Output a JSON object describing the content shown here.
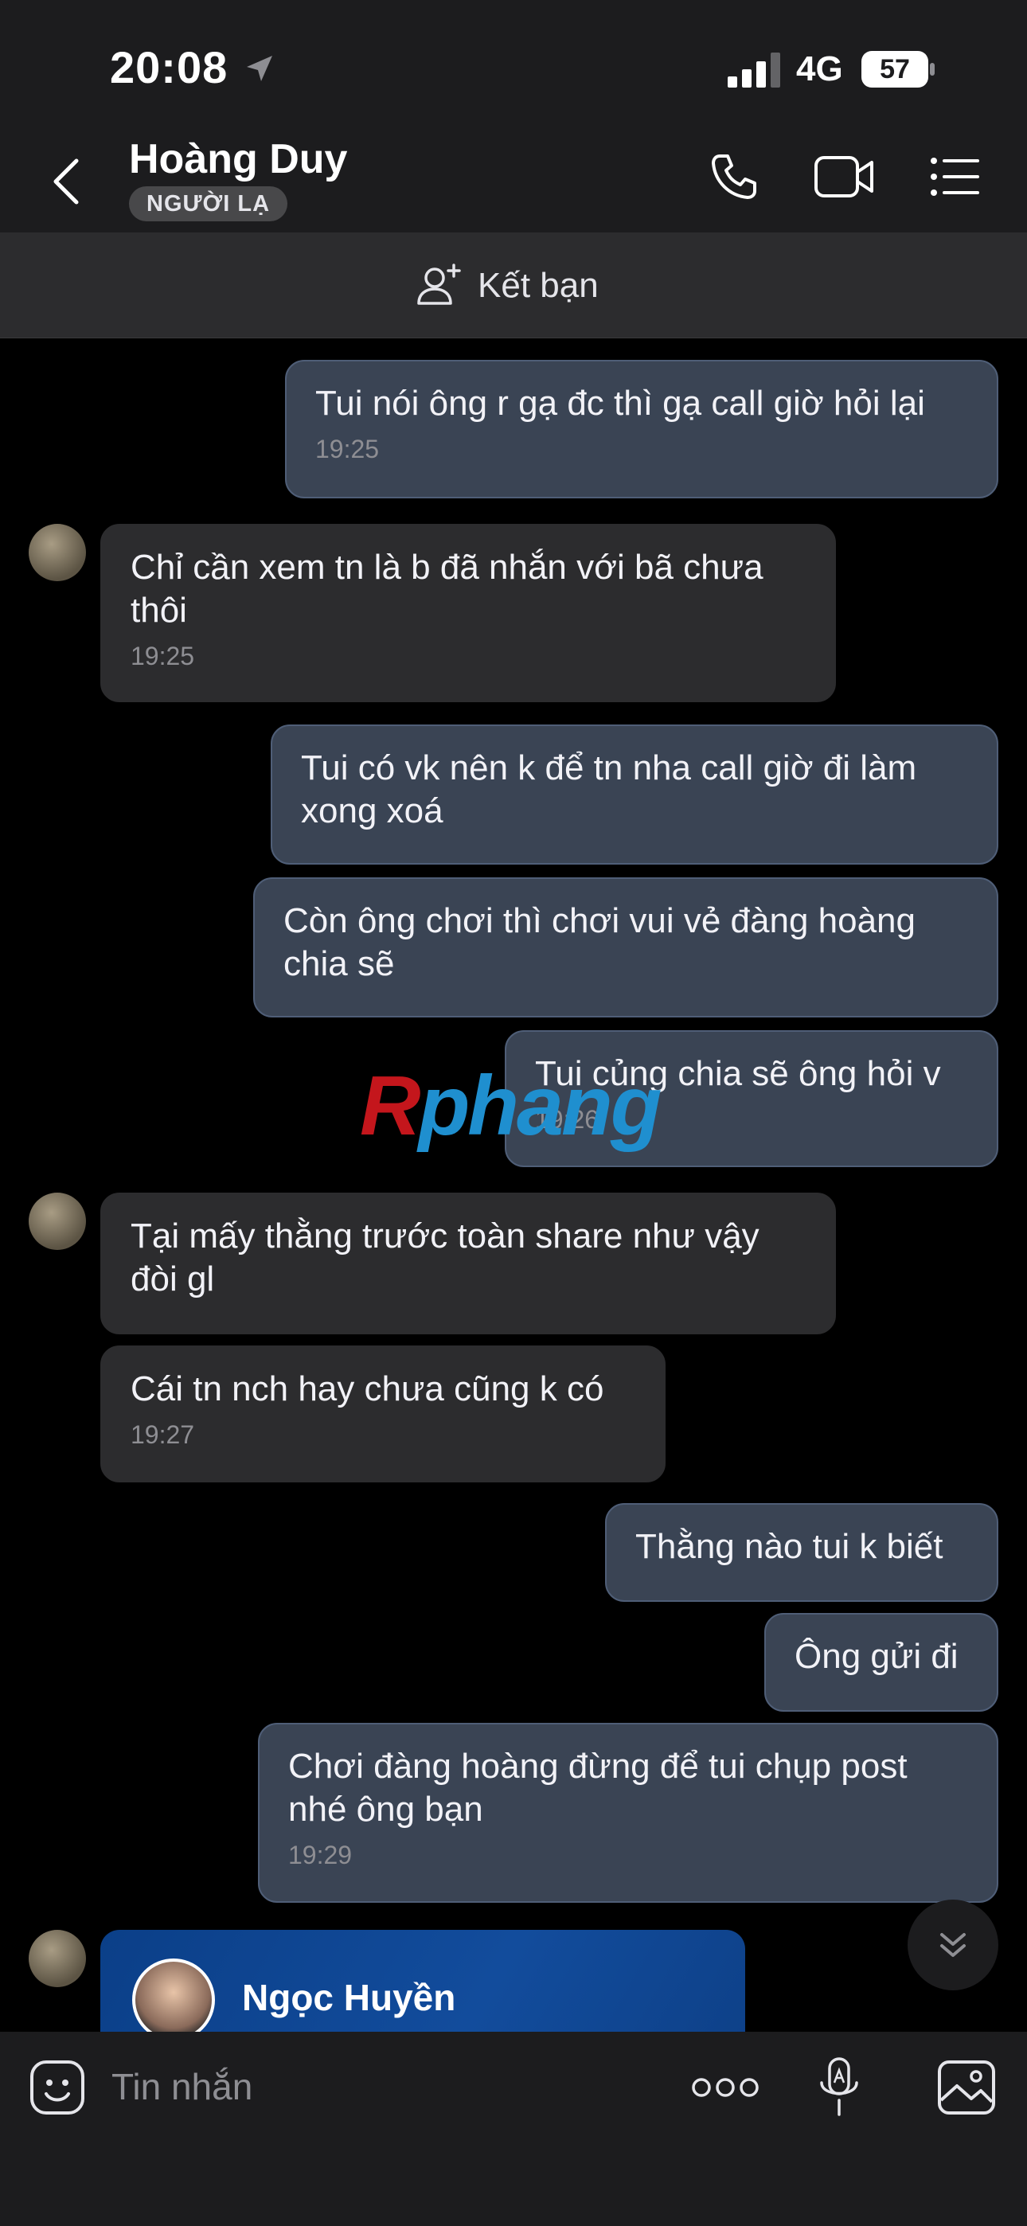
{
  "status_bar": {
    "time": "20:08",
    "network": "4G",
    "battery": "57"
  },
  "header": {
    "contact_name": "Hoàng Duy",
    "badge": "NGƯỜI LẠ",
    "icons": [
      "back-icon",
      "phone-icon",
      "video-call-icon",
      "menu-list-icon"
    ]
  },
  "friend_bar": {
    "label": "Kết bạn",
    "icon": "add-friend-icon"
  },
  "messages": [
    {
      "from": "me",
      "text": "Tui nói ông r gạ đc thì gạ call giờ hỏi lại",
      "time": "19:25"
    },
    {
      "from": "them",
      "text": "Chỉ cần xem tn là b đã nhắn với bã chưa thôi",
      "time": "19:25"
    },
    {
      "from": "me",
      "text": "Tui có vk nên k để tn nha call giờ đi làm xong xoá",
      "time": ""
    },
    {
      "from": "me",
      "text": "Còn ông chơi thì chơi vui vẻ đàng hoàng chia sẽ",
      "time": ""
    },
    {
      "from": "me",
      "text": "Tui củng chia sẽ ông hỏi v",
      "time": "19:26"
    },
    {
      "from": "them",
      "text": "Tại mấy thằng trước toàn share như vậy đòi gl",
      "time": ""
    },
    {
      "from": "them",
      "text": "Cái tn nch hay chưa cũng k có",
      "time": "19:27"
    },
    {
      "from": "me",
      "text": "Thằng nào tui k biết",
      "time": ""
    },
    {
      "from": "me",
      "text": "Ông gửi đi",
      "time": ""
    },
    {
      "from": "me",
      "text": "Chơi đàng hoàng đừng để tui chụp post nhé ông bạn",
      "time": "19:29"
    }
  ],
  "watermark": {
    "first": "R",
    "rest": "phang"
  },
  "contact_card": {
    "name": "Ngọc Huyền"
  },
  "input": {
    "placeholder": "Tin nhắn",
    "icons": [
      "sticker-icon",
      "more-icon",
      "voice-icon",
      "image-icon"
    ]
  },
  "colors": {
    "header_bg": "#1c1c1e",
    "my_bubble": "#3a4454",
    "their_bubble": "#2c2c2e",
    "card": "#124c9c"
  }
}
